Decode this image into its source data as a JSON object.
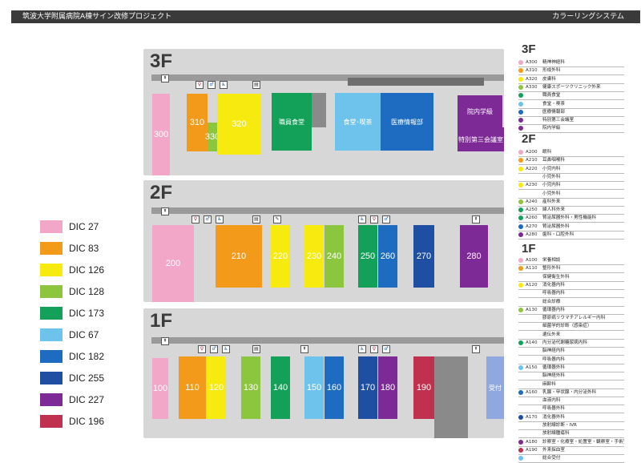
{
  "header": {
    "title": "筑波大学附属病院A棟サイン改修プロジェクト",
    "subtitle": "カラーリングシステム"
  },
  "colors": {
    "dic27": "#f2a6c8",
    "dic83": "#f39a1a",
    "dic126": "#f6ea0f",
    "dic128": "#8cc63f",
    "dic173": "#13a15a",
    "dic67": "#6ec3ec",
    "dic182": "#1d6cc1",
    "dic255": "#1e4fa3",
    "dic227": "#7d2a96",
    "dic196": "#c0304f"
  },
  "floors": {
    "f3": {
      "label": "3F",
      "rooms": {
        "r300": "300",
        "r310": "310",
        "r320": "320",
        "r330": "330",
        "staff_dining": "職員食堂",
        "cafe": "食堂･喫茶",
        "med_info": "医療情報部",
        "school": "院内学級",
        "conf3": "特別第三会議室"
      }
    },
    "f2": {
      "label": "2F",
      "rooms": {
        "r200": "200",
        "r210": "210",
        "r220": "220",
        "r230": "230",
        "r240": "240",
        "r250": "250",
        "r260": "260",
        "r270": "270",
        "r280": "280"
      }
    },
    "f1": {
      "label": "1F",
      "rooms": {
        "r100": "100",
        "r110": "110",
        "r120": "120",
        "r130": "130",
        "r140": "140",
        "r150": "150",
        "r160": "160",
        "r170": "170",
        "r180": "180",
        "r190": "190",
        "reception": "受付"
      }
    }
  },
  "legend": [
    {
      "label": "DIC 27",
      "color": "#f2a6c8"
    },
    {
      "label": "DIC 83",
      "color": "#f39a1a"
    },
    {
      "label": "DIC 126",
      "color": "#f6ea0f"
    },
    {
      "label": "DIC 128",
      "color": "#8cc63f"
    },
    {
      "label": "DIC 173",
      "color": "#13a15a"
    },
    {
      "label": "DIC 67",
      "color": "#6ec3ec"
    },
    {
      "label": "DIC 182",
      "color": "#1d6cc1"
    },
    {
      "label": "DIC 255",
      "color": "#1e4fa3"
    },
    {
      "label": "DIC 227",
      "color": "#7d2a96"
    },
    {
      "label": "DIC 196",
      "color": "#c0304f"
    }
  ],
  "index": {
    "f3": {
      "label": "3F",
      "rows": [
        {
          "code": "A300",
          "name": "精神神経科",
          "color": "#f2a6c8"
        },
        {
          "code": "A310",
          "name": "形成外科",
          "color": "#f39a1a"
        },
        {
          "code": "A320",
          "name": "皮膚科",
          "color": "#f6ea0f"
        },
        {
          "code": "A330",
          "name": "健康スポーツクリニック外来",
          "color": "#8cc63f"
        },
        {
          "code": "",
          "name": "職員食堂",
          "color": "#13a15a"
        },
        {
          "code": "",
          "name": "食堂・喫茶",
          "color": "#6ec3ec"
        },
        {
          "code": "",
          "name": "医療情報部",
          "color": "#1d6cc1"
        },
        {
          "code": "",
          "name": "特別第三会議室",
          "color": "#7d2a96"
        },
        {
          "code": "",
          "name": "院内学級",
          "color": "#7d2a96"
        }
      ]
    },
    "f2": {
      "label": "2F",
      "rows": [
        {
          "code": "A200",
          "name": "眼科",
          "color": "#f2a6c8"
        },
        {
          "code": "A210",
          "name": "耳鼻咽喉科",
          "color": "#f39a1a"
        },
        {
          "code": "A220",
          "name": "小児内科",
          "color": "#f6ea0f"
        },
        {
          "code": "",
          "name": "小児外科",
          "color": ""
        },
        {
          "code": "A230",
          "name": "小児内科",
          "color": "#f6ea0f"
        },
        {
          "code": "",
          "name": "小児外科",
          "color": ""
        },
        {
          "code": "A240",
          "name": "産科外来",
          "color": "#8cc63f"
        },
        {
          "code": "A250",
          "name": "婦人科外来",
          "color": "#13a15a"
        },
        {
          "code": "A260",
          "name": "腎泌尿器外科・男性機能科",
          "color": "#13a15a"
        },
        {
          "code": "A270",
          "name": "腎泌尿器外科",
          "color": "#1d6cc1"
        },
        {
          "code": "A280",
          "name": "歯科・口腔外科",
          "color": "#7d2a96"
        }
      ]
    },
    "f1": {
      "label": "1F",
      "rows": [
        {
          "code": "A100",
          "name": "栄養相談",
          "color": "#f2a6c8"
        },
        {
          "code": "A110",
          "name": "整形外科",
          "color": "#f39a1a"
        },
        {
          "code": "",
          "name": "保健衛生外科",
          "color": ""
        },
        {
          "code": "A120",
          "name": "消化器内科",
          "color": "#f6ea0f"
        },
        {
          "code": "",
          "name": "呼吸器内科",
          "color": ""
        },
        {
          "code": "",
          "name": "総合診療",
          "color": ""
        },
        {
          "code": "A130",
          "name": "循環器内科",
          "color": "#8cc63f"
        },
        {
          "code": "",
          "name": "膠原病リウマチアレルギー内科",
          "color": ""
        },
        {
          "code": "",
          "name": "細菌学的診断（感染症）",
          "color": ""
        },
        {
          "code": "",
          "name": "遺伝外来",
          "color": ""
        },
        {
          "code": "A140",
          "name": "内分泌代謝糖尿病内科",
          "color": "#13a15a"
        },
        {
          "code": "",
          "name": "脳神経内科",
          "color": ""
        },
        {
          "code": "",
          "name": "呼吸器内科",
          "color": ""
        },
        {
          "code": "A150",
          "name": "循環器外科",
          "color": "#6ec3ec"
        },
        {
          "code": "",
          "name": "脳神経外科",
          "color": ""
        },
        {
          "code": "",
          "name": "麻酔科",
          "color": ""
        },
        {
          "code": "A160",
          "name": "乳腺・甲状腺・内分泌外科",
          "color": "#1d6cc1"
        },
        {
          "code": "",
          "name": "血液内科",
          "color": ""
        },
        {
          "code": "",
          "name": "呼吸器外科",
          "color": ""
        },
        {
          "code": "A170",
          "name": "消化器外科",
          "color": "#1e4fa3"
        },
        {
          "code": "",
          "name": "放射線診断・IVR",
          "color": ""
        },
        {
          "code": "",
          "name": "放射線腫瘍科",
          "color": ""
        },
        {
          "code": "A180",
          "name": "診察室・化療室・処置室・観察室・手術室",
          "color": "#7d2a96"
        },
        {
          "code": "A190",
          "name": "外来採血室",
          "color": "#c0304f"
        },
        {
          "code": "",
          "name": "総合受付",
          "color": "#6ec3ec"
        }
      ]
    }
  }
}
